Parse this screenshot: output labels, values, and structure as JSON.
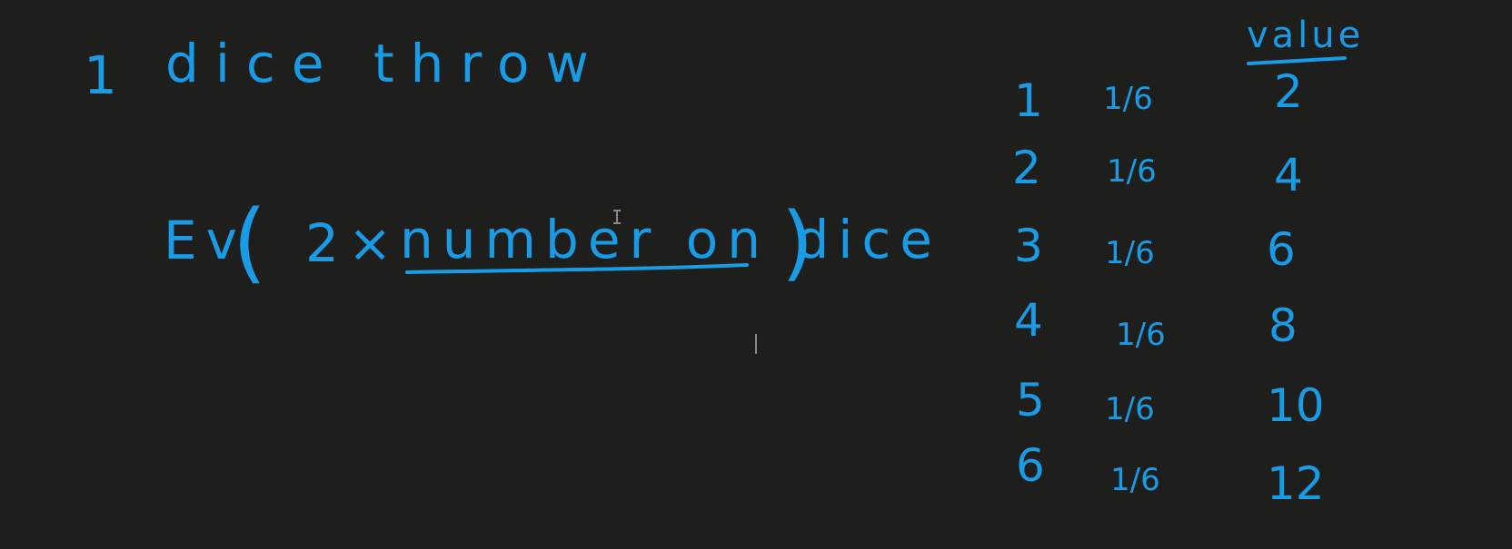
{
  "board": {
    "background": "#1e1e1c",
    "ink_color": "#1a9be6"
  },
  "title": {
    "number": "1",
    "words": "dice throw"
  },
  "expression": {
    "prefix": "Ev",
    "open_paren": "(",
    "factor": "2×",
    "underlined": "number on dice",
    "close_paren": ")"
  },
  "table": {
    "value_header": "value",
    "rows": [
      {
        "outcome": "1",
        "probability": "1/6",
        "value": "2"
      },
      {
        "outcome": "2",
        "probability": "1/6",
        "value": "4"
      },
      {
        "outcome": "3",
        "probability": "1/6",
        "value": "6"
      },
      {
        "outcome": "4",
        "probability": "1/6",
        "value": "8"
      },
      {
        "outcome": "5",
        "probability": "1/6",
        "value": "10"
      },
      {
        "outcome": "6",
        "probability": "1/6",
        "value": "12"
      }
    ]
  },
  "cursor_icon": "text-cursor-icon"
}
